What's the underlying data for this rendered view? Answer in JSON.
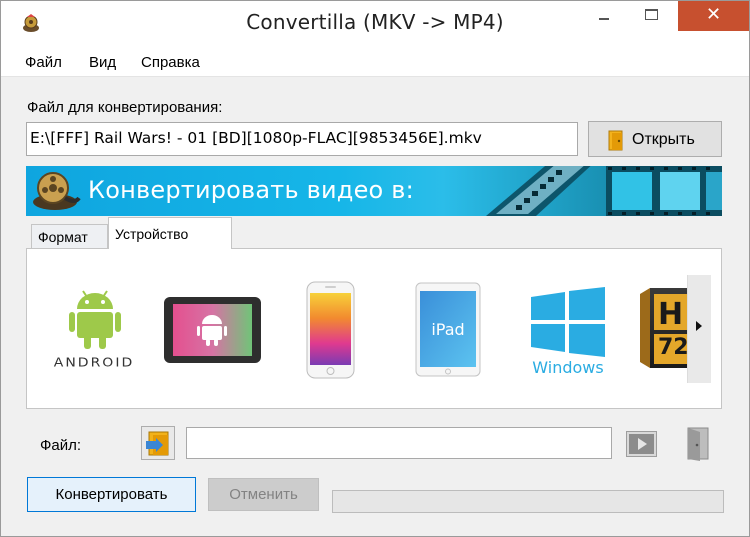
{
  "window": {
    "title": "Convertilla  (MKV -> MP4)",
    "close_glyph": "✕"
  },
  "menu": {
    "items": [
      "Файл",
      "Вид",
      "Справка"
    ]
  },
  "source": {
    "label": "Файл для конвертирования:",
    "path": "E:\\[FFF] Rail Wars! - 01 [BD][1080p-FLAC][9853456E].mkv",
    "open_button": "Открыть"
  },
  "banner": {
    "text": "Конвертировать видео в:"
  },
  "tabs": [
    {
      "label": "Формат",
      "active": false
    },
    {
      "label": "Устройство",
      "active": true
    }
  ],
  "devices": [
    {
      "name": "android",
      "icon": "android-icon",
      "caption": "ANDROID"
    },
    {
      "name": "android-tablet",
      "icon": "android-tablet-icon"
    },
    {
      "name": "iphone",
      "icon": "iphone-icon"
    },
    {
      "name": "ipad",
      "icon": "ipad-icon",
      "caption": "iPad"
    },
    {
      "name": "windows",
      "icon": "windows-icon",
      "caption": "Windows"
    },
    {
      "name": "hd-720",
      "icon": "hd-720-icon",
      "caption": "72"
    }
  ],
  "output": {
    "label": "Файл:",
    "value": ""
  },
  "actions": {
    "convert": "Конвертировать",
    "cancel": "Отменить"
  },
  "progress": {
    "value": 0
  },
  "colors": {
    "banner": "#16b6e8",
    "accent_border": "#0078d7",
    "close_button": "#c7502f",
    "android_green": "#9ec94a",
    "windows_blue": "#2aace2"
  }
}
